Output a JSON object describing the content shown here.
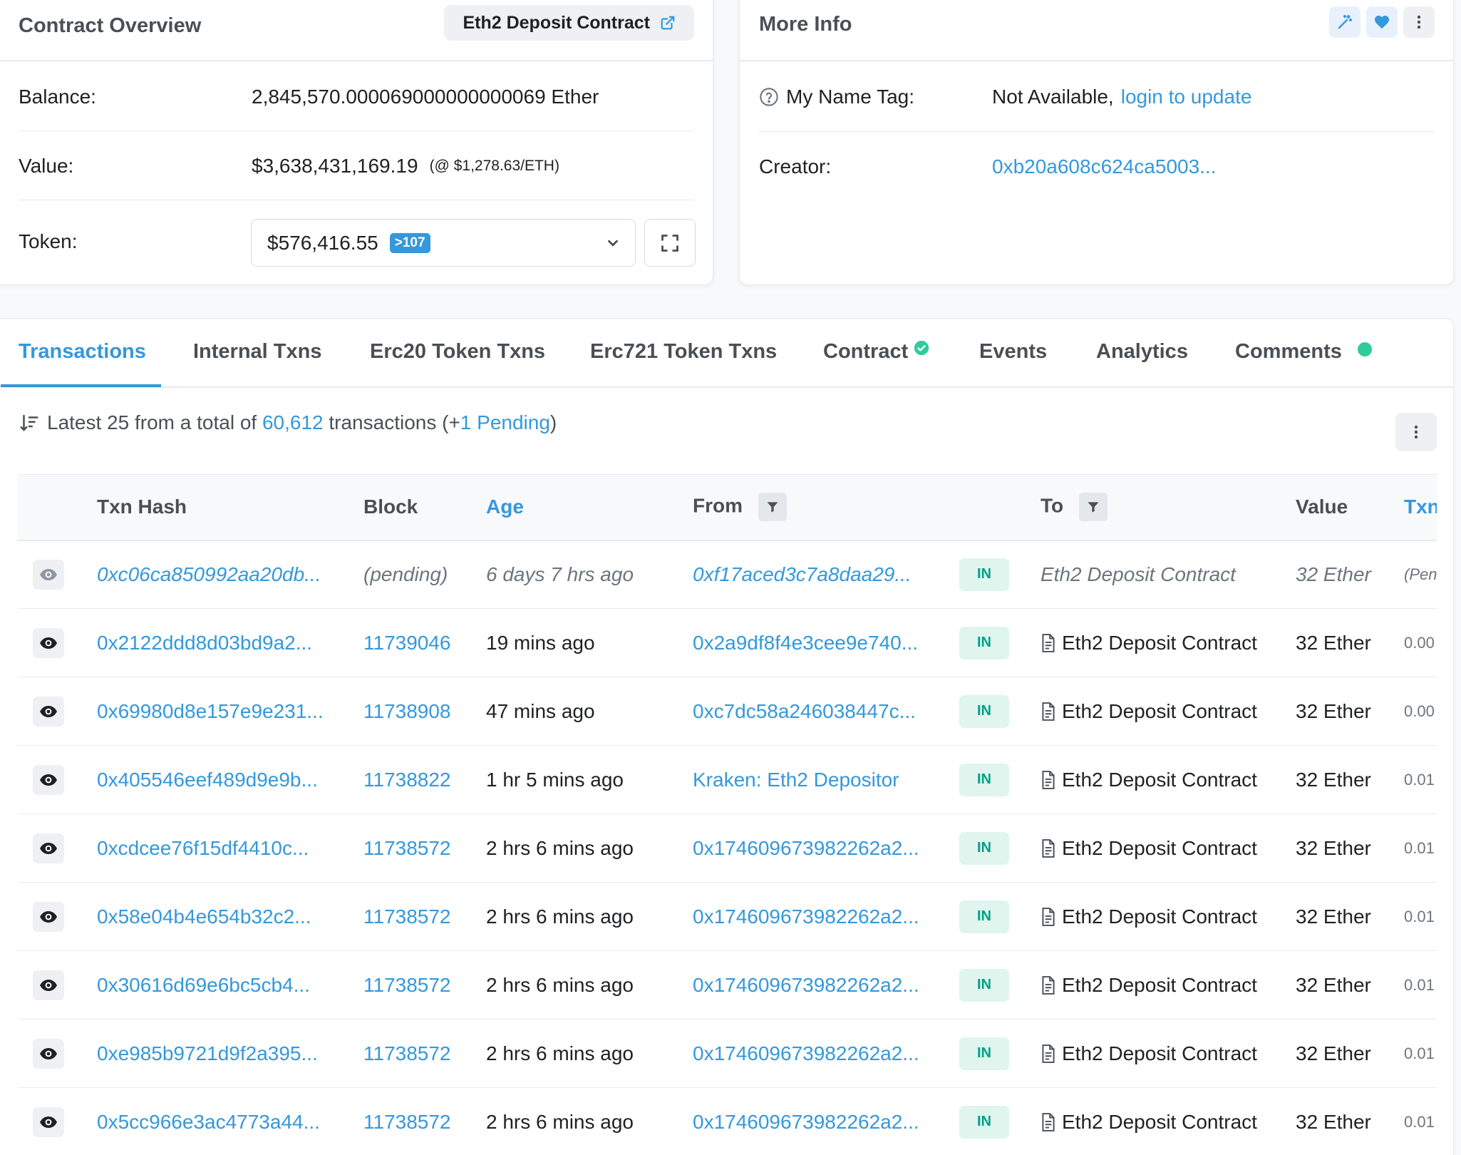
{
  "overview": {
    "title": "Contract Overview",
    "contract_chip": "Eth2 Deposit Contract",
    "balance_label": "Balance:",
    "balance_value": "2,845,570.000069000000000069 Ether",
    "value_label": "Value:",
    "value_amount": "$3,638,431,169.19",
    "value_rate": "(@ $1,278.63/ETH)",
    "token_label": "Token:",
    "token_value": "$576,416.55",
    "token_count": ">107"
  },
  "more_info": {
    "title": "More Info",
    "name_tag_label": "My Name Tag:",
    "name_tag_value": "Not Available,",
    "name_tag_link": "login to update",
    "creator_label": "Creator:",
    "creator_value": "0xb20a608c624ca5003..."
  },
  "tabs": [
    {
      "label": "Transactions"
    },
    {
      "label": "Internal Txns"
    },
    {
      "label": "Erc20 Token Txns"
    },
    {
      "label": "Erc721 Token Txns"
    },
    {
      "label": "Contract"
    },
    {
      "label": "Events"
    },
    {
      "label": "Analytics"
    },
    {
      "label": "Comments"
    }
  ],
  "summary": {
    "prefix": "Latest 25 from a total of",
    "total": "60,612",
    "middle": "transactions (+",
    "pending": "1 Pending",
    "suffix": ")"
  },
  "table": {
    "headers": {
      "hash": "Txn Hash",
      "block": "Block",
      "age": "Age",
      "from": "From",
      "to": "To",
      "value": "Value",
      "fee": "Txn"
    },
    "rows": [
      {
        "hash": "0xc06ca850992aa20db...",
        "block": "(pending)",
        "age": "6 days 7 hrs ago",
        "from": "0xf17aced3c7a8daa29...",
        "dir": "IN",
        "to": "Eth2 Deposit Contract",
        "value": "32 Ether",
        "fee": "(Pen"
      },
      {
        "hash": "0x2122ddd8d03bd9a2...",
        "block": "11739046",
        "age": "19 mins ago",
        "from": "0x2a9df8f4e3cee9e740...",
        "dir": "IN",
        "to": "Eth2 Deposit Contract",
        "value": "32 Ether",
        "fee": "0.00"
      },
      {
        "hash": "0x69980d8e157e9e231...",
        "block": "11738908",
        "age": "47 mins ago",
        "from": "0xc7dc58a246038447c...",
        "dir": "IN",
        "to": "Eth2 Deposit Contract",
        "value": "32 Ether",
        "fee": "0.00"
      },
      {
        "hash": "0x405546eef489d9e9b...",
        "block": "11738822",
        "age": "1 hr 5 mins ago",
        "from": "Kraken: Eth2 Depositor",
        "dir": "IN",
        "to": "Eth2 Deposit Contract",
        "value": "32 Ether",
        "fee": "0.01"
      },
      {
        "hash": "0xcdcee76f15df4410c...",
        "block": "11738572",
        "age": "2 hrs 6 mins ago",
        "from": "0x174609673982262a2...",
        "dir": "IN",
        "to": "Eth2 Deposit Contract",
        "value": "32 Ether",
        "fee": "0.01"
      },
      {
        "hash": "0x58e04b4e654b32c2...",
        "block": "11738572",
        "age": "2 hrs 6 mins ago",
        "from": "0x174609673982262a2...",
        "dir": "IN",
        "to": "Eth2 Deposit Contract",
        "value": "32 Ether",
        "fee": "0.01"
      },
      {
        "hash": "0x30616d69e6bc5cb4...",
        "block": "11738572",
        "age": "2 hrs 6 mins ago",
        "from": "0x174609673982262a2...",
        "dir": "IN",
        "to": "Eth2 Deposit Contract",
        "value": "32 Ether",
        "fee": "0.01"
      },
      {
        "hash": "0xe985b9721d9f2a395...",
        "block": "11738572",
        "age": "2 hrs 6 mins ago",
        "from": "0x174609673982262a2...",
        "dir": "IN",
        "to": "Eth2 Deposit Contract",
        "value": "32 Ether",
        "fee": "0.01"
      },
      {
        "hash": "0x5cc966e3ac4773a44...",
        "block": "11738572",
        "age": "2 hrs 6 mins ago",
        "from": "0x174609673982262a2...",
        "dir": "IN",
        "to": "Eth2 Deposit Contract",
        "value": "32 Ether",
        "fee": "0.01"
      }
    ]
  },
  "icons": {
    "external_link": "external-link-icon",
    "expand": "expand-icon",
    "chevron": "chevron-down-icon",
    "help": "question-circle-icon",
    "magic": "magic-wand-icon",
    "heart": "heart-icon",
    "more": "more-vertical-icon",
    "sort": "sort-desc-icon",
    "eye": "eye-icon",
    "filter": "filter-icon",
    "document": "document-icon"
  },
  "colors": {
    "link": "#3498db",
    "in_badge_bg": "#dff5ee",
    "in_badge_text": "#00a186",
    "status_dot": "#2ecc9a"
  }
}
